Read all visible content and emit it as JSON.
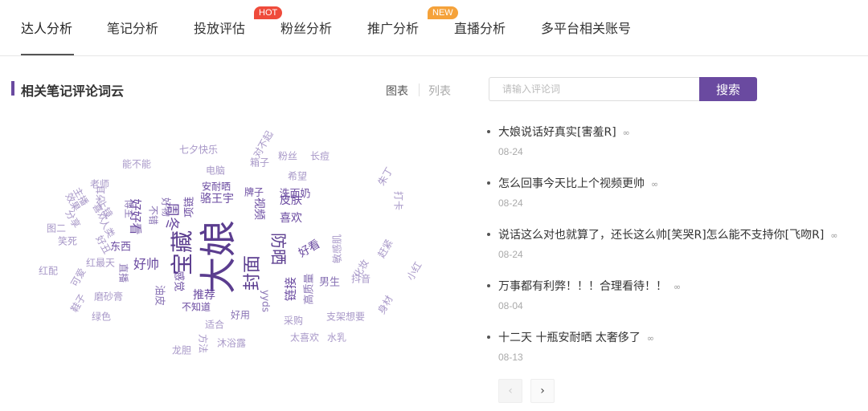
{
  "tabs": [
    {
      "label": "达人分析",
      "badge": ""
    },
    {
      "label": "笔记分析",
      "badge": ""
    },
    {
      "label": "投放评估",
      "badge": "HOT"
    },
    {
      "label": "粉丝分析",
      "badge": ""
    },
    {
      "label": "推广分析",
      "badge": "NEW"
    },
    {
      "label": "直播分析",
      "badge": ""
    },
    {
      "label": "多平台相关账号",
      "badge": ""
    }
  ],
  "section": {
    "title": "相关笔记评论词云",
    "view_chart": "图表",
    "view_list": "列表"
  },
  "search": {
    "placeholder": "请输入评论词",
    "button": "搜索"
  },
  "comments": [
    {
      "text": "大娘说话好真实[害羞R]",
      "date": "08-24"
    },
    {
      "text": "怎么回事今天比上个视频更帅",
      "date": "08-24"
    },
    {
      "text": "说话这么对也就算了，还长这么帅[笑哭R]怎么能不支持你[飞吻R]",
      "date": "08-24"
    },
    {
      "text": "万事都有利弊！！！合理看待！！",
      "date": "08-04"
    },
    {
      "text": "十二天 十瓶安耐晒 太奢侈了",
      "date": "08-13"
    }
  ],
  "pager": {
    "prev": "‹",
    "next": "›"
  },
  "icons": {
    "link": "link-icon"
  },
  "colors": {
    "accent": "#6a4aa0",
    "hot": "#ef4b3b",
    "new": "#f5a23a"
  },
  "word_cloud": [
    {
      "w": "大娘",
      "s": 46,
      "c": "#5b3d8f",
      "r": -90
    },
    {
      "w": "宝藏",
      "s": 28,
      "c": "#5b3d8f",
      "r": -90
    },
    {
      "w": "封面",
      "s": 22,
      "c": "#5b3d8f",
      "r": -90
    },
    {
      "w": "防晒",
      "s": 20,
      "c": "#5b3d8f",
      "r": 90
    },
    {
      "w": "周冬",
      "s": 18,
      "c": "#6a4aa0",
      "r": 90
    },
    {
      "w": "好帅",
      "s": 16,
      "c": "#6a4aa0",
      "r": 0
    },
    {
      "w": "好好看",
      "s": 15,
      "c": "#6a4aa0",
      "r": 90
    },
    {
      "w": "链接",
      "s": 15,
      "c": "#6a4aa0",
      "r": -90
    },
    {
      "w": "视频",
      "s": 14,
      "c": "#6a4aa0",
      "r": 90
    },
    {
      "w": "骆王宇",
      "s": 14,
      "c": "#6a4aa0",
      "r": 0
    },
    {
      "w": "推荐",
      "s": 14,
      "c": "#6a4aa0",
      "r": 0
    },
    {
      "w": "喜欢",
      "s": 14,
      "c": "#6a4aa0",
      "r": 0
    },
    {
      "w": "皮肤",
      "s": 14,
      "c": "#6a4aa0",
      "r": 0
    },
    {
      "w": "好看",
      "s": 14,
      "c": "#6a4aa0",
      "r": -30
    },
    {
      "w": "项链",
      "s": 13,
      "c": "#6a4aa0",
      "r": -90
    },
    {
      "w": "东西",
      "s": 13,
      "c": "#6a4aa0",
      "r": 0
    },
    {
      "w": "感觉",
      "s": 13,
      "c": "#6a4aa0",
      "r": 90
    },
    {
      "w": "男生",
      "s": 13,
      "c": "#8a74b5",
      "r": 0
    },
    {
      "w": "高质量",
      "s": 13,
      "c": "#8a74b5",
      "r": -90
    },
    {
      "w": "油皮",
      "s": 13,
      "c": "#8a74b5",
      "r": 90
    },
    {
      "w": "洗面奶",
      "s": 13,
      "c": "#6a4aa0",
      "r": 0
    },
    {
      "w": "安耐晒",
      "s": 12,
      "c": "#6a4aa0",
      "r": 0
    },
    {
      "w": "牌子",
      "s": 12,
      "c": "#6a4aa0",
      "r": 0
    },
    {
      "w": "不知道",
      "s": 12,
      "c": "#6a4aa0",
      "r": 0
    },
    {
      "w": "好用",
      "s": 12,
      "c": "#8a74b5",
      "r": 0
    },
    {
      "w": "好物",
      "s": 12,
      "c": "#8a74b5",
      "r": 90
    },
    {
      "w": "不错",
      "s": 12,
      "c": "#8a74b5",
      "r": 90
    },
    {
      "w": "博主",
      "s": 12,
      "c": "#8a74b5",
      "r": 90
    },
    {
      "w": "电脑",
      "s": 12,
      "c": "#a898c8",
      "r": 0
    },
    {
      "w": "箱子",
      "s": 12,
      "c": "#a898c8",
      "r": 0
    },
    {
      "w": "粉丝",
      "s": 12,
      "c": "#a898c8",
      "r": 0
    },
    {
      "w": "长痘",
      "s": 12,
      "c": "#a898c8",
      "r": 0
    },
    {
      "w": "七夕快乐",
      "s": 12,
      "c": "#a898c8",
      "r": 0
    },
    {
      "w": "能不能",
      "s": 12,
      "c": "#a898c8",
      "r": 0
    },
    {
      "w": "老师",
      "s": 12,
      "c": "#a898c8",
      "r": 0
    },
    {
      "w": "笑死",
      "s": 12,
      "c": "#a898c8",
      "r": 0
    },
    {
      "w": "图二",
      "s": 12,
      "c": "#a898c8",
      "r": 0
    },
    {
      "w": "红配",
      "s": 12,
      "c": "#a898c8",
      "r": 0
    },
    {
      "w": "红最天",
      "s": 12,
      "c": "#a898c8",
      "r": 0
    },
    {
      "w": "磨砂膏",
      "s": 12,
      "c": "#a898c8",
      "r": 0
    },
    {
      "w": "绿色",
      "s": 12,
      "c": "#a898c8",
      "r": 0
    },
    {
      "w": "适合",
      "s": 12,
      "c": "#a898c8",
      "r": 0
    },
    {
      "w": "沐浴露",
      "s": 12,
      "c": "#a898c8",
      "r": 0
    },
    {
      "w": "龙胆",
      "s": 12,
      "c": "#a898c8",
      "r": 0
    },
    {
      "w": "太喜欢",
      "s": 12,
      "c": "#a898c8",
      "r": 0
    },
    {
      "w": "水乳",
      "s": 12,
      "c": "#a898c8",
      "r": 0
    },
    {
      "w": "抖音",
      "s": 12,
      "c": "#a898c8",
      "r": 0
    },
    {
      "w": "采购",
      "s": 12,
      "c": "#a898c8",
      "r": 0
    },
    {
      "w": "支架想要",
      "s": 12,
      "c": "#a898c8",
      "r": 0
    },
    {
      "w": "敏感肌",
      "s": 12,
      "c": "#a898c8",
      "r": -90
    },
    {
      "w": "希望",
      "s": 12,
      "c": "#a898c8",
      "r": 0
    },
    {
      "w": "yyds",
      "s": 12,
      "c": "#8a74b5",
      "r": 90
    },
    {
      "w": "小红",
      "s": 12,
      "c": "#a898c8",
      "r": -60
    },
    {
      "w": "方法",
      "s": 12,
      "c": "#a898c8",
      "r": 90
    },
    {
      "w": "朱丁",
      "s": 12,
      "c": "#a898c8",
      "r": -60
    },
    {
      "w": "赶紧",
      "s": 12,
      "c": "#a898c8",
      "r": -60
    },
    {
      "w": "鞋子",
      "s": 12,
      "c": "#a898c8",
      "r": -60
    },
    {
      "w": "可爱",
      "s": 12,
      "c": "#a898c8",
      "r": -60
    },
    {
      "w": "效果",
      "s": 12,
      "c": "#a898c8",
      "r": 60
    },
    {
      "w": "分享",
      "s": 12,
      "c": "#a898c8",
      "r": 60
    },
    {
      "w": "喜欢",
      "s": 12,
      "c": "#a898c8",
      "r": 60
    },
    {
      "w": "人类",
      "s": 12,
      "c": "#a898c8",
      "r": 60
    },
    {
      "w": "耳朵",
      "s": 12,
      "c": "#a898c8",
      "r": 90
    },
    {
      "w": "直播",
      "s": 12,
      "c": "#8a74b5",
      "r": 90
    },
    {
      "w": "好丑",
      "s": 12,
      "c": "#a898c8",
      "r": 60
    },
    {
      "w": "上镜",
      "s": 12,
      "c": "#a898c8",
      "r": 60
    },
    {
      "w": "化妆",
      "s": 12,
      "c": "#a898c8",
      "r": -60
    },
    {
      "w": "身材",
      "s": 12,
      "c": "#a898c8",
      "r": -60
    },
    {
      "w": "主播",
      "s": 12,
      "c": "#a898c8",
      "r": 60
    },
    {
      "w": "对不起",
      "s": 12,
      "c": "#a898c8",
      "r": -60
    },
    {
      "w": "打卡",
      "s": 12,
      "c": "#a898c8",
      "r": 90
    }
  ]
}
